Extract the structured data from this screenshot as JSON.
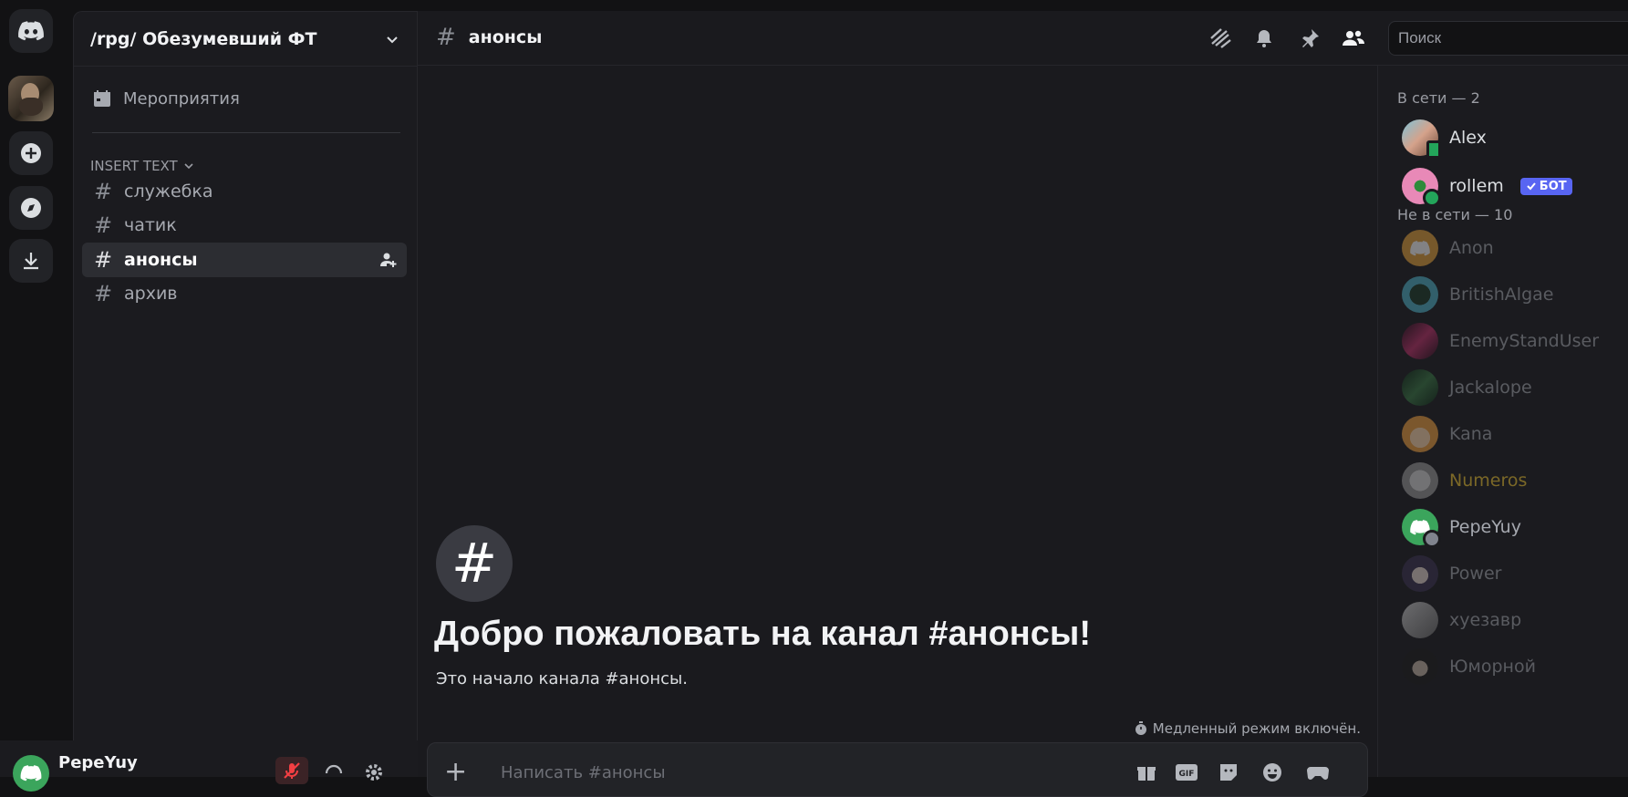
{
  "server": {
    "name": "/rpg/ Обезумевший ФТ"
  },
  "sidebar": {
    "events_label": "Мероприятия",
    "category": "INSERT TEXT",
    "channels": [
      {
        "name": "служебка"
      },
      {
        "name": "чатик"
      },
      {
        "name": "анонсы"
      },
      {
        "name": "архив"
      }
    ]
  },
  "user": {
    "name": "PepeYuy"
  },
  "channel_header": {
    "name": "анонсы",
    "search_placeholder": "Поиск"
  },
  "welcome": {
    "hash": "#",
    "title": "Добро пожаловать на канал #анонсы!",
    "subtitle": "Это начало канала #анонсы."
  },
  "slowmode": "Медленный режим включён.",
  "composer": {
    "placeholder": "Написать #анонсы"
  },
  "members": {
    "online_header": "В сети — 2",
    "offline_header": "Не в сети — 10",
    "online": [
      {
        "name": "Alex"
      },
      {
        "name": "rollem",
        "badge": "БОТ"
      }
    ],
    "offline": [
      {
        "name": "Anon"
      },
      {
        "name": "BritishAlgae"
      },
      {
        "name": "EnemyStandUser"
      },
      {
        "name": "Jackalope"
      },
      {
        "name": "Kana"
      },
      {
        "name": "Numeros"
      },
      {
        "name": "PepeYuy"
      },
      {
        "name": "Power"
      },
      {
        "name": "хуезавр"
      },
      {
        "name": "Юморной"
      }
    ]
  },
  "colors": {
    "accent": "#5865f2",
    "online_status": "#23a55a",
    "numeros_name": "#a9901f",
    "pepe_avatar": "#3ba55c"
  }
}
